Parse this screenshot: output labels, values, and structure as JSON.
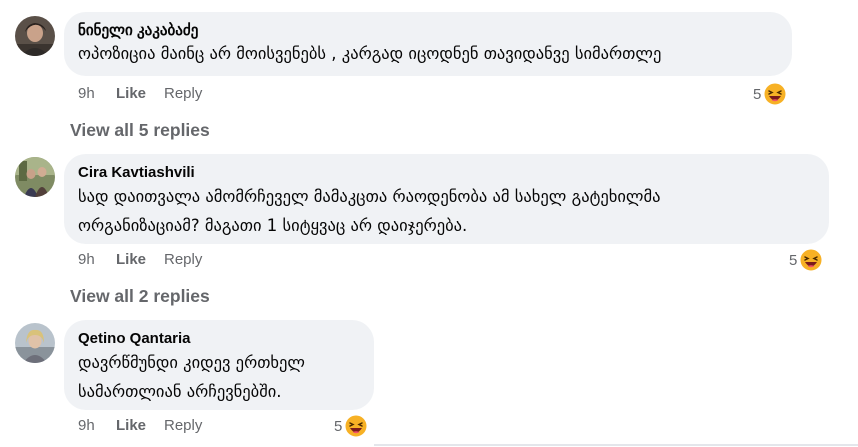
{
  "comments": [
    {
      "author": "ნინელი კაკაბაძე",
      "text": "ოპოზიცია მაინც არ მოისვენებს , კარგად იცოდნენ თავიდანვე სიმართლე",
      "time": "9h",
      "like_label": "Like",
      "reply_label": "Reply",
      "reaction_count": "5",
      "reaction_icon": "haha-emoji-icon",
      "replies_link": "View all 5 replies"
    },
    {
      "author": "Cira Kavtiashvili",
      "text": "სად დაითვალა ამომრჩეველ მამაკცთა რაოდენობა ამ სახელ გატეხილმა\nორგანიზაციამ? მაგათი 1 სიტყვაც არ დაიჯერება.",
      "time": "9h",
      "like_label": "Like",
      "reply_label": "Reply",
      "reaction_count": "5",
      "reaction_icon": "haha-emoji-icon",
      "replies_link": "View all 2 replies"
    },
    {
      "author": "Qetino Qantaria",
      "text": "დავრწმუნდი კიდევ ერთხელ\nსამართლიან არჩევნებში.",
      "time": "9h",
      "like_label": "Like",
      "reply_label": "Reply",
      "reaction_count": "5",
      "reaction_icon": "haha-emoji-icon"
    }
  ],
  "colors": {
    "bubble": "#f0f2f5",
    "secondary_text": "#65676b",
    "emoji_face": "#f7b125",
    "emoji_mouth": "#7a1a1a"
  }
}
